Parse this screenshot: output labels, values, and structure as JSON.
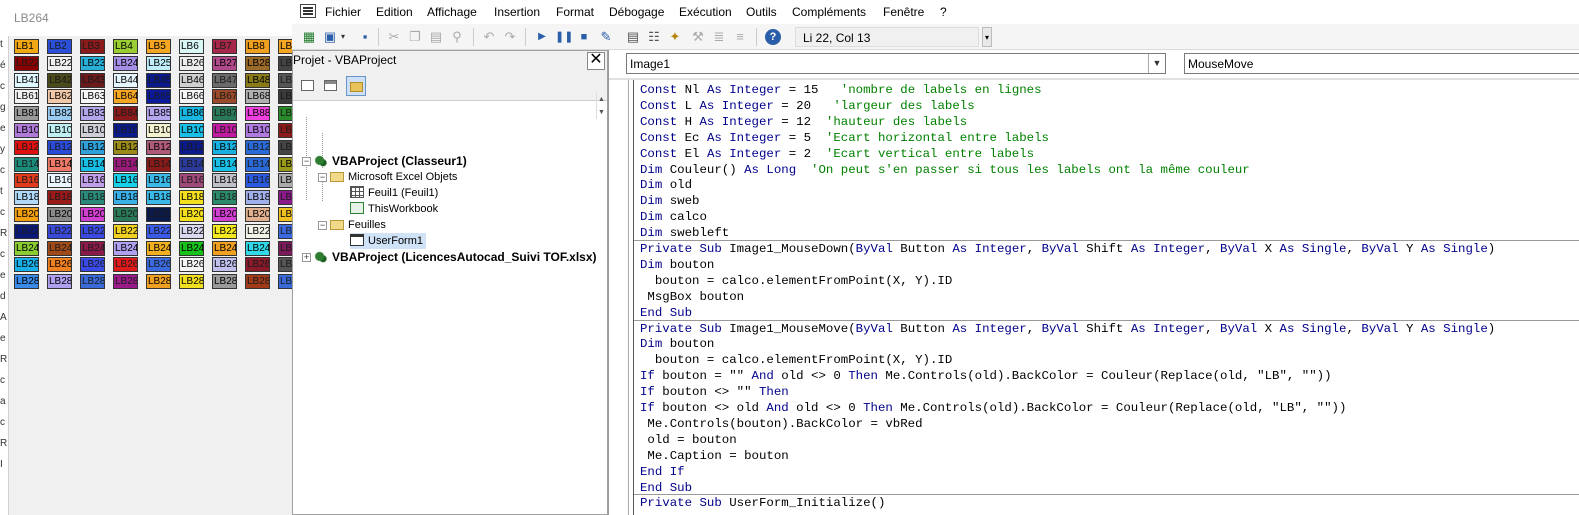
{
  "userform": {
    "title": "LB264",
    "edge_letters": [
      "t",
      "é",
      "c",
      "g",
      "e",
      "y",
      "c",
      "t",
      "c",
      "R",
      "c",
      "e",
      "d",
      "A",
      "e",
      "R",
      "c",
      "a",
      "c",
      "R",
      "I"
    ],
    "rows": [
      [
        [
          "LB1",
          "#f2a813"
        ],
        [
          "LB2",
          "#2b4fd8"
        ],
        [
          "LB3",
          "#8b1a1a"
        ],
        [
          "LB4",
          "#9acd32"
        ],
        [
          "LB5",
          "#f5a623"
        ],
        [
          "LB6",
          "#d9f7f5"
        ],
        [
          "LB7",
          "#a5284a"
        ],
        [
          "LB8",
          "#f0a020"
        ],
        [
          "LB",
          "#f5a623"
        ]
      ],
      [
        [
          "LB22",
          "#8b0000"
        ],
        [
          "LB22",
          "#f0f0f0"
        ],
        [
          "LB23",
          "#29b0d8"
        ],
        [
          "LB24",
          "#a48ee6"
        ],
        [
          "LB25",
          "#bfeefa"
        ],
        [
          "LB26",
          "#ededed"
        ],
        [
          "LB27",
          "#b04a8a"
        ],
        [
          "LB28",
          "#9c6b2a"
        ],
        [
          "LB",
          "#444"
        ]
      ],
      [
        [
          "LB41",
          "#e0f8ff"
        ],
        [
          "LB42",
          "#4a4a1a"
        ],
        [
          "LB43",
          "#6a1a1a"
        ],
        [
          "LB44",
          "#e6f6ff"
        ],
        [
          "LB45",
          "#0a1a8a"
        ],
        [
          "LB46",
          "#d0d0d0"
        ],
        [
          "LB47",
          "#6a6a6a"
        ],
        [
          "LB48",
          "#8a7a1a"
        ],
        [
          "LB",
          "#555"
        ]
      ],
      [
        [
          "LB61",
          "#f2f2f2"
        ],
        [
          "LB62",
          "#f2c9a8"
        ],
        [
          "LB63",
          "#f8f8f8"
        ],
        [
          "LB64",
          "#f5a623"
        ],
        [
          "LB65",
          "#0a1a9a"
        ],
        [
          "LB66",
          "#f5f5f5"
        ],
        [
          "LB67",
          "#9a4a2a"
        ],
        [
          "LB68",
          "#b0b0b0"
        ],
        [
          "LB",
          "#3a3a3a"
        ]
      ],
      [
        [
          "LB81",
          "#9a9a9a"
        ],
        [
          "LB82",
          "#9acbf0"
        ],
        [
          "LB83",
          "#b3a6ea"
        ],
        [
          "LB84",
          "#8a1a1a"
        ],
        [
          "LB85",
          "#b6a6ee"
        ],
        [
          "LB86",
          "#18b6e0"
        ],
        [
          "LB87",
          "#2a7a5a"
        ],
        [
          "LB88",
          "#f040e0"
        ],
        [
          "LB",
          "#2a8a2a"
        ]
      ],
      [
        [
          "LB10",
          "#b07ad8"
        ],
        [
          "LB10",
          "#bfeff2"
        ],
        [
          "LB10",
          "#cfcfd8"
        ],
        [
          "LB10",
          "#0a1a8a"
        ],
        [
          "LB10",
          "#f2f2d0"
        ],
        [
          "LB10",
          "#18c0e8"
        ],
        [
          "LB10",
          "#c01aa0"
        ],
        [
          "LB10",
          "#b07ae0"
        ],
        [
          "LB",
          "#8a1a1a"
        ]
      ],
      [
        [
          "LB12",
          "#e01010"
        ],
        [
          "LB12",
          "#2a4ad8"
        ],
        [
          "LB12",
          "#30a0d8"
        ],
        [
          "LB12",
          "#9a8a1a"
        ],
        [
          "LB12",
          "#b05a7a"
        ],
        [
          "LB12",
          "#0a1a8a"
        ],
        [
          "LB12",
          "#18b0e0"
        ],
        [
          "LB12",
          "#2a6ad8"
        ],
        [
          "LB",
          "#444"
        ]
      ],
      [
        [
          "LB14",
          "#1a8a7a"
        ],
        [
          "LB14",
          "#f07a6a"
        ],
        [
          "LB14",
          "#18c0e8"
        ],
        [
          "LB14",
          "#9a1a7a"
        ],
        [
          "LB14",
          "#8a1a1a"
        ],
        [
          "LB14",
          "#2a3a9a"
        ],
        [
          "LB14",
          "#18c0e8"
        ],
        [
          "LB14",
          "#2a6ad8"
        ],
        [
          "LB",
          "#9a9a1a"
        ]
      ],
      [
        [
          "LB16",
          "#e03a1a"
        ],
        [
          "LB16",
          "#eaf6ff"
        ],
        [
          "LB16",
          "#c0a0ea"
        ],
        [
          "LB16",
          "#18d0e8"
        ],
        [
          "LB16",
          "#3ab8e8"
        ],
        [
          "LB16",
          "#a04a7a"
        ],
        [
          "LB16",
          "#c0c0c8"
        ],
        [
          "LB16",
          "#2a5ae0"
        ],
        [
          "LB",
          "#aaa"
        ]
      ],
      [
        [
          "LB18",
          "#b0d8f8"
        ],
        [
          "LB18",
          "#9a1a1a"
        ],
        [
          "LB18",
          "#2a8a7a"
        ],
        [
          "LB18",
          "#3ab0e8"
        ],
        [
          "LB18",
          "#3ab8e8"
        ],
        [
          "LB18",
          "#f5e020"
        ],
        [
          "LB18",
          "#2a8a6a"
        ],
        [
          "LB18",
          "#a0b0ea"
        ],
        [
          "LB",
          "#8a1a8a"
        ]
      ],
      [
        [
          "LB20",
          "#f0a010"
        ],
        [
          "LB20",
          "#8a8a8a"
        ],
        [
          "LB20",
          "#d040d0"
        ],
        [
          "LB20",
          "#2a7a5a"
        ],
        [
          "LB20",
          "#0a1a4a"
        ],
        [
          "LB20",
          "#f5e020"
        ],
        [
          "LB20",
          "#d040d0"
        ],
        [
          "LB20",
          "#e0b090"
        ],
        [
          "LB",
          "#f0c020"
        ]
      ],
      [
        [
          "LB22",
          "#0a1a7a"
        ],
        [
          "LB22",
          "#3a4ad8"
        ],
        [
          "LB22",
          "#3a4ae0"
        ],
        [
          "LB22",
          "#f0d020"
        ],
        [
          "LB22",
          "#3a5ae8"
        ],
        [
          "LB22",
          "#d8d8f0"
        ],
        [
          "LB22",
          "#f5ea20"
        ],
        [
          "LB22",
          "#f2f2e8"
        ],
        [
          "LB",
          "#3a6ae0"
        ]
      ],
      [
        [
          "LB24",
          "#8acd32"
        ],
        [
          "LB24",
          "#a04a1a"
        ],
        [
          "LB24",
          "#8a1a4a"
        ],
        [
          "LB24",
          "#b0a0ee"
        ],
        [
          "LB24",
          "#f0b020"
        ],
        [
          "LB24",
          "#18c01a"
        ],
        [
          "LB24",
          "#f0a020"
        ],
        [
          "LB24",
          "#30d8e8"
        ],
        [
          "LB",
          "#7a1a5a"
        ]
      ],
      [
        [
          "LB26",
          "#18b0e8"
        ],
        [
          "LB26",
          "#f08020"
        ],
        [
          "LB26",
          "#3a4ae8"
        ],
        [
          "LB26",
          "#e01a1a"
        ],
        [
          "LB26",
          "#3a6ae0"
        ],
        [
          "LB26",
          "#f5f5f5"
        ],
        [
          "LB26",
          "#c0c0ee"
        ],
        [
          "LB26",
          "#8a1a2a"
        ],
        [
          "LB",
          "#555"
        ]
      ],
      [
        [
          "LB28",
          "#3a8ae8"
        ],
        [
          "LB28",
          "#b0a0ee"
        ],
        [
          "LB28",
          "#3a6ad8"
        ],
        [
          "LB28",
          "#9a1a8a"
        ],
        [
          "LB28",
          "#f0a020"
        ],
        [
          "LB28",
          "#f0e020"
        ],
        [
          "LB28",
          "#9a9a9a"
        ],
        [
          "LB28",
          "#a03a1a"
        ],
        [
          "LB",
          "#3a6ad8"
        ]
      ]
    ]
  },
  "menu": {
    "items": [
      "Fichier",
      "Edition",
      "Affichage",
      "Insertion",
      "Format",
      "Débogage",
      "Exécution",
      "Outils",
      "Compléments",
      "Fenêtre",
      "?"
    ]
  },
  "toolbar": {
    "position": "Li 22, Col 13"
  },
  "project": {
    "title": "Projet - VBAProject",
    "close_glyph": "✕",
    "tree": {
      "project1": "VBAProject (Classeur1)",
      "folder_objects": "Microsoft Excel Objets",
      "sheet1": "Feuil1 (Feuil1)",
      "workbook": "ThisWorkbook",
      "folder_forms": "Feuilles",
      "userform": "UserForm1",
      "project2": "VBAProject (LicencesAutocad_Suivi TOF.xlsx)"
    }
  },
  "code": {
    "object_combo": "Image1",
    "proc_combo": "MouseMove",
    "lines": [
      [
        [
          "kw",
          "Const"
        ],
        [
          "",
          "  Nl "
        ],
        [
          "kw",
          "As Integer"
        ],
        [
          "",
          "  = 15     "
        ],
        [
          "cm",
          "'nombre de labels en lignes"
        ]
      ],
      [
        [
          "kw",
          "Const"
        ],
        [
          "",
          "  L "
        ],
        [
          "kw",
          "As Integer"
        ],
        [
          "",
          "  = 20     "
        ],
        [
          "cm",
          "'largeur des labels"
        ]
      ],
      [
        [
          "kw",
          "Const"
        ],
        [
          "",
          "  H "
        ],
        [
          "kw",
          "As Integer"
        ],
        [
          "",
          "  = 12   "
        ],
        [
          "cm",
          "'hauteur des labels"
        ]
      ],
      [
        [
          "kw",
          "Const"
        ],
        [
          "",
          "  Ec "
        ],
        [
          "kw",
          "As Integer"
        ],
        [
          "",
          "  = 5    "
        ],
        [
          "cm",
          "'Ecart horizontal entre labels"
        ]
      ],
      [
        [
          "kw",
          "Const"
        ],
        [
          "",
          "  El "
        ],
        [
          "kw",
          "As Integer"
        ],
        [
          "",
          "  = 2    "
        ],
        [
          "cm",
          "'Ecart vertical entre labels"
        ]
      ],
      [
        [
          "kw",
          "Dim"
        ],
        [
          "",
          "  Couleur() "
        ],
        [
          "kw",
          "As Long"
        ],
        [
          "",
          "    "
        ],
        [
          "cm",
          "'On peut s'en passer si tous les labels ont la même couleur"
        ]
      ],
      [
        [
          "kw",
          "Dim"
        ],
        [
          "",
          "  old"
        ]
      ],
      [
        [
          "kw",
          "Dim"
        ],
        [
          "",
          "  sweb"
        ]
      ],
      [
        [
          "kw",
          "Dim"
        ],
        [
          "",
          "  calco"
        ]
      ],
      [
        [
          "kw",
          "Dim"
        ],
        [
          "",
          "  swebleft"
        ]
      ],
      [
        [
          "kw",
          "Private Sub"
        ],
        [
          "",
          "  Image1_MouseDown("
        ],
        [
          "kw",
          "ByVal"
        ],
        [
          "",
          "  Button "
        ],
        [
          "kw",
          "As Integer"
        ],
        [
          "",
          ",  "
        ],
        [
          "kw",
          "ByVal"
        ],
        [
          "",
          "  Shift "
        ],
        [
          "kw",
          "As Integer"
        ],
        [
          "",
          ",  "
        ],
        [
          "kw",
          "ByVal"
        ],
        [
          "",
          "  X "
        ],
        [
          "kw",
          "As Single"
        ],
        [
          "",
          ",  "
        ],
        [
          "kw",
          "ByVal"
        ],
        [
          "",
          "  Y "
        ],
        [
          "kw",
          "As Single"
        ],
        [
          "",
          ")"
        ]
      ],
      [
        [
          "kw",
          "Dim"
        ],
        [
          "",
          "  bouton"
        ]
      ],
      [
        [
          "",
          "   bouton = calco.elementFromPoint(X, Y).ID"
        ]
      ],
      [
        [
          "",
          "  MsgBox bouton"
        ]
      ],
      [
        [
          "kw",
          "End Sub"
        ]
      ],
      [
        [
          "kw",
          "Private Sub"
        ],
        [
          "",
          "  Image1_MouseMove("
        ],
        [
          "kw",
          "ByVal"
        ],
        [
          "",
          "  Button "
        ],
        [
          "kw",
          "As Integer"
        ],
        [
          "",
          ",  "
        ],
        [
          "kw",
          "ByVal"
        ],
        [
          "",
          "  Shift "
        ],
        [
          "kw",
          "As Integer"
        ],
        [
          "",
          ",  "
        ],
        [
          "kw",
          "ByVal"
        ],
        [
          "",
          "  X "
        ],
        [
          "kw",
          "As Single"
        ],
        [
          "",
          ",  "
        ],
        [
          "kw",
          "ByVal"
        ],
        [
          "",
          "  Y "
        ],
        [
          "kw",
          "As Single"
        ],
        [
          "",
          ")"
        ]
      ],
      [
        [
          "kw",
          "Dim"
        ],
        [
          "",
          "  bouton"
        ]
      ],
      [
        [
          "",
          "   bouton = calco.elementFromPoint(X, Y).ID"
        ]
      ],
      [
        [
          "kw",
          "If"
        ],
        [
          "",
          "  bouton = \"\" "
        ],
        [
          "kw",
          "And"
        ],
        [
          "",
          "  old <> 0 "
        ],
        [
          "kw",
          "Then"
        ],
        [
          "",
          "  Me.Controls(old).BackColor = Couleur(Replace(old, \"LB\", \"\"))"
        ]
      ],
      [
        [
          "kw",
          "If"
        ],
        [
          "",
          "  bouton <> \"\" "
        ],
        [
          "kw",
          "Then"
        ]
      ],
      [
        [
          "kw",
          "If"
        ],
        [
          "",
          "  bouton <> old "
        ],
        [
          "kw",
          "And"
        ],
        [
          "",
          "  old <> 0 "
        ],
        [
          "kw",
          "Then"
        ],
        [
          "",
          "  Me.Controls(old).BackColor = Couleur(Replace(old, \"LB\", \"\"))"
        ]
      ],
      [
        [
          "",
          "  Me.Controls(bouton).BackColor = vbRed"
        ]
      ],
      [
        [
          "",
          "  old = bouton"
        ]
      ],
      [
        [
          "",
          "  Me.Caption = bouton"
        ]
      ],
      [
        [
          "kw",
          "End If"
        ]
      ],
      [
        [
          "kw",
          "End Sub"
        ]
      ],
      [
        [
          "kw",
          "Private Sub"
        ],
        [
          "",
          "  UserForm_Initialize()"
        ]
      ]
    ]
  }
}
